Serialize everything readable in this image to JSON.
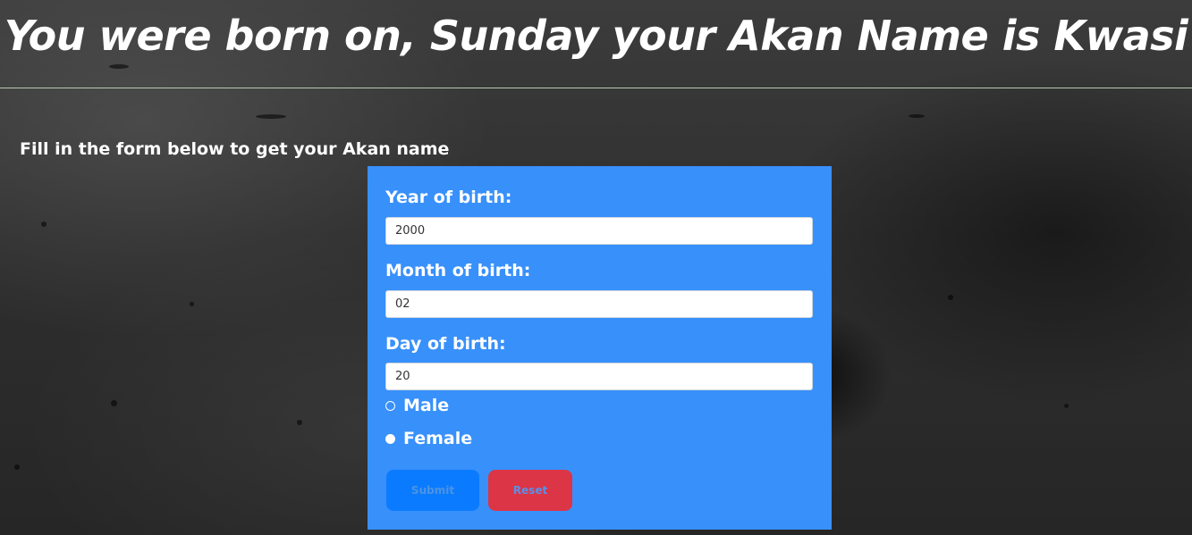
{
  "header": {
    "result_text": "You were born on, Sunday your Akan Name is Kwasi"
  },
  "instruction": "Fill in the form below to get your Akan name",
  "form": {
    "year_label": "Year of birth:",
    "year_value": "2000",
    "month_label": "Month of birth:",
    "month_value": "02",
    "day_label": "Day of birth:",
    "day_value": "20",
    "gender_options": [
      {
        "label": "Male",
        "selected": false
      },
      {
        "label": "Female",
        "selected": true
      }
    ],
    "submit_label": "Submit",
    "reset_label": "Reset"
  },
  "colors": {
    "form_background": "#3890fb",
    "submit_button": "#0a7bff",
    "reset_button": "#dc3546",
    "text": "#ffffff"
  }
}
